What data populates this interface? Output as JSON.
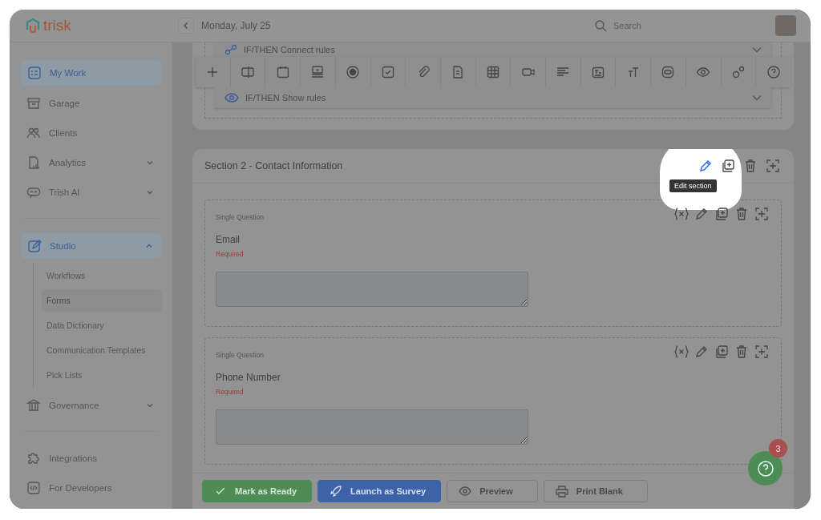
{
  "header": {
    "logo": "trisk",
    "date": "Monday, July 25",
    "search": {
      "placeholder": "Search"
    }
  },
  "sidebar": {
    "groups": [
      [
        {
          "label": "My Work",
          "kind": "link",
          "selected": true
        },
        {
          "label": "Garage",
          "kind": "link",
          "selected": false
        },
        {
          "label": "Clients",
          "kind": "link",
          "selected": false
        },
        {
          "label": "Analytics",
          "kind": "menu",
          "selected": false,
          "expanded": false
        },
        {
          "label": "Trish AI",
          "kind": "menu",
          "selected": false,
          "expanded": false
        }
      ],
      [
        {
          "label": "Studio",
          "kind": "menu",
          "selected": true,
          "expanded": true,
          "children": [
            {
              "label": "Workflows",
              "selected": false
            },
            {
              "label": "Forms",
              "selected": true
            },
            {
              "label": "Data Dictionary",
              "selected": false
            },
            {
              "label": "Communication Templates",
              "selected": false
            },
            {
              "label": "Pick Lists",
              "selected": false
            }
          ]
        },
        {
          "label": "Governance",
          "kind": "menu",
          "selected": false,
          "expanded": false
        }
      ],
      [
        {
          "label": "Integrations",
          "kind": "link",
          "selected": false
        },
        {
          "label": "For Developers",
          "kind": "link",
          "selected": false
        }
      ]
    ]
  },
  "rules": [
    {
      "label": "IF/THEN Connect rules"
    },
    {
      "label": "IF/THEN Show rules"
    }
  ],
  "section": {
    "title": "Section 2 - Contact Information",
    "tooltip": "Edit section",
    "questions": [
      {
        "type": "Single Question",
        "label": "Email",
        "note": "Required"
      },
      {
        "type": "Single Question",
        "label": "Phone Number",
        "note": "Required"
      }
    ]
  },
  "actions": [
    {
      "label": "Mark as Ready",
      "kind": "success"
    },
    {
      "label": "Launch as Survey",
      "kind": "primary"
    },
    {
      "label": "Preview",
      "kind": "outline"
    },
    {
      "label": "Print Blank",
      "kind": "outline"
    }
  ],
  "help": {
    "badge": "3"
  }
}
